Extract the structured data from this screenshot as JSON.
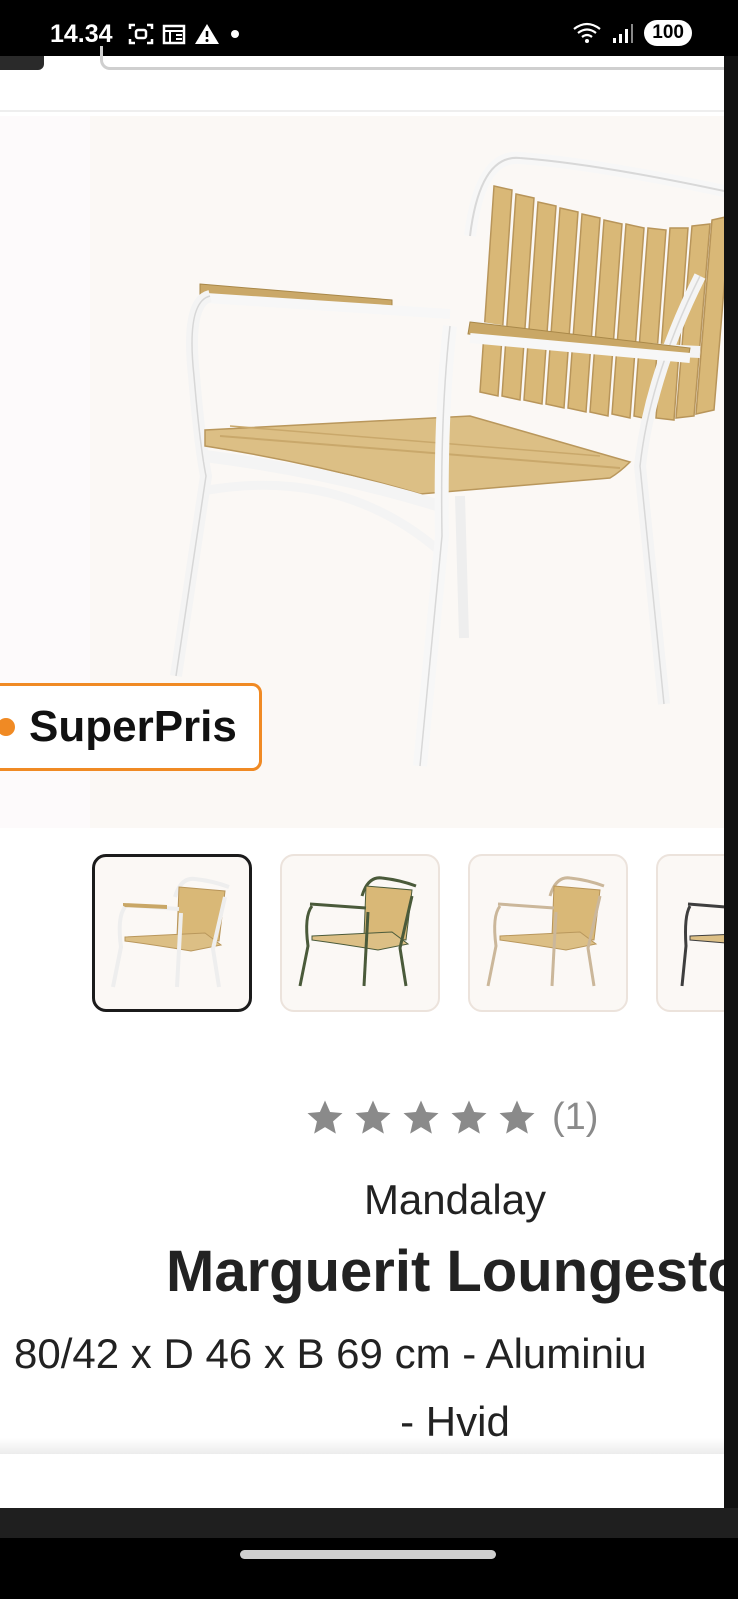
{
  "status_bar": {
    "time": "14.34",
    "battery": "100",
    "icons_left": [
      "screenshot-icon",
      "calendar-icon",
      "warning-icon",
      "dot-icon"
    ],
    "icons_right": [
      "wifi-icon",
      "signal-icon",
      "battery-icon"
    ]
  },
  "hero": {
    "badge_label": "SuperPris",
    "badge_color": "#f08a24",
    "image": "chair-image"
  },
  "thumbnails": {
    "selected_index": 0,
    "items": [
      {
        "image": "chair-white-frame"
      },
      {
        "image": "chair-green-frame"
      },
      {
        "image": "chair-beige-frame"
      },
      {
        "image": "chair-dark-frame"
      }
    ]
  },
  "product": {
    "rating_value": 5,
    "rating_count": "(1)",
    "brand": "Mandalay",
    "title": "Marguerit Loungesto",
    "description_line1": "80/42 x D 46 x B 69 cm - Aluminiu",
    "description_line2": "- Hvid"
  },
  "colors": {
    "accent": "#f08a24",
    "star": "#8a8a8a",
    "text": "#222222"
  }
}
